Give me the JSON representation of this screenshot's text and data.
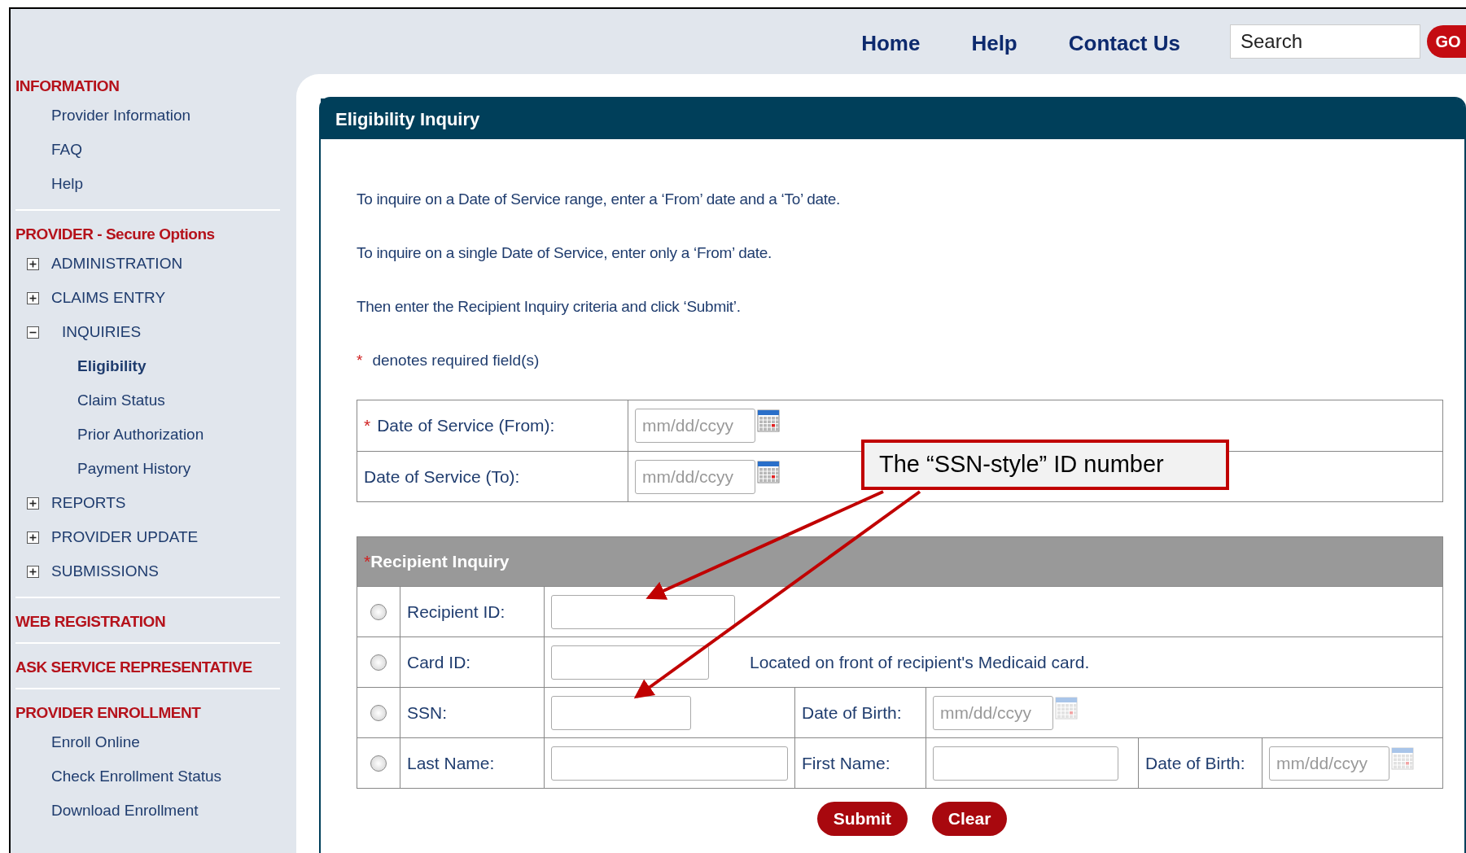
{
  "top_nav": {
    "links": [
      "Home",
      "Help",
      "Contact Us"
    ],
    "search": {
      "value": "Search"
    },
    "go_button": "GO"
  },
  "sidebar": {
    "sections": [
      {
        "title": "INFORMATION",
        "items": [
          {
            "label": "Provider Information"
          },
          {
            "label": "FAQ"
          },
          {
            "label": "Help"
          }
        ]
      },
      {
        "title": "PROVIDER - Secure Options",
        "items": [
          {
            "label": "ADMINISTRATION",
            "expanded": false
          },
          {
            "label": "CLAIMS ENTRY",
            "expanded": false
          },
          {
            "label": "INQUIRIES",
            "expanded": true,
            "children": [
              {
                "label": "Eligibility",
                "selected": true
              },
              {
                "label": "Claim Status",
                "selected": false
              },
              {
                "label": "Prior Authorization",
                "selected": false
              },
              {
                "label": "Payment History",
                "selected": false
              }
            ]
          },
          {
            "label": "REPORTS",
            "expanded": false
          },
          {
            "label": "PROVIDER UPDATE",
            "expanded": false
          },
          {
            "label": "SUBMISSIONS",
            "expanded": false
          }
        ]
      },
      {
        "title": "WEB REGISTRATION"
      },
      {
        "title": "ASK SERVICE REPRESENTATIVE"
      },
      {
        "title": "PROVIDER ENROLLMENT",
        "items": [
          {
            "label": "Enroll Online"
          },
          {
            "label": "Check Enrollment Status"
          },
          {
            "label": "Download Enrollment"
          }
        ]
      }
    ]
  },
  "panel": {
    "title": "Eligibility Inquiry",
    "instructions": [
      "To inquire on a Date of Service range, enter a ‘From’ date and a ‘To’ date.",
      "To inquire on a single Date of Service, enter only a ‘From’ date.",
      "Then enter the Recipient Inquiry criteria and click ‘Submit’."
    ],
    "required_note": {
      "mark": "*",
      "text": "denotes required field(s)"
    },
    "date_fields": [
      {
        "label": "Date of Service (From):",
        "required": true,
        "placeholder": "mm/dd/ccyy"
      },
      {
        "label": "Date of Service (To):",
        "required": false,
        "placeholder": "mm/dd/ccyy"
      }
    ],
    "recipient": {
      "title": "Recipient Inquiry",
      "required": true,
      "rows": [
        {
          "selected": false,
          "cells": [
            {
              "kind": "label",
              "text": "Recipient ID:"
            },
            {
              "kind": "input"
            }
          ]
        },
        {
          "selected": false,
          "cells": [
            {
              "kind": "label",
              "text": "Card ID:"
            },
            {
              "kind": "input",
              "note": "Located on front of recipient's Medicaid card."
            }
          ]
        },
        {
          "selected": false,
          "cells": [
            {
              "kind": "label",
              "text": "SSN:"
            },
            {
              "kind": "input"
            },
            {
              "kind": "label",
              "text": "Date of Birth:"
            },
            {
              "kind": "date",
              "placeholder": "mm/dd/ccyy"
            }
          ]
        },
        {
          "selected": false,
          "cells": [
            {
              "kind": "label",
              "text": "Last Name:"
            },
            {
              "kind": "input"
            },
            {
              "kind": "label",
              "text": "First Name:"
            },
            {
              "kind": "input"
            },
            {
              "kind": "label",
              "text": "Date of Birth:"
            },
            {
              "kind": "date",
              "placeholder": "mm/dd/ccyy"
            }
          ]
        }
      ]
    },
    "buttons": [
      "Submit",
      "Clear"
    ]
  },
  "callout": {
    "text": "The “SSN-style” ID number"
  }
}
